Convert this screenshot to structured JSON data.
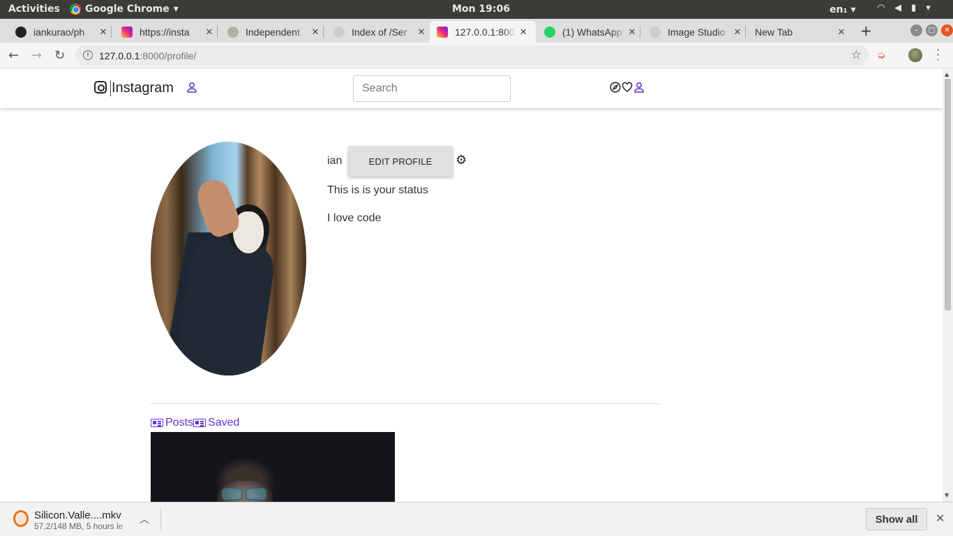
{
  "os_topbar": {
    "activities": "Activities",
    "app_name": "Google Chrome",
    "clock": "Mon 19:06",
    "lang": "en₁ ▾"
  },
  "tabs": [
    {
      "title": "iankurao/ph",
      "icon": "github-icon",
      "color": "#222222"
    },
    {
      "title": "https://insta",
      "icon": "instagram-icon",
      "color": "#d62976"
    },
    {
      "title": "Independent",
      "icon": "globe-icon",
      "color": "#6a7a5a"
    },
    {
      "title": "Index of /Ser",
      "icon": "page-icon",
      "color": "#555555"
    },
    {
      "title": "127.0.0.1:800",
      "icon": "instagram-icon",
      "color": "#d62976",
      "active": true
    },
    {
      "title": "(1) WhatsApp",
      "icon": "whatsapp-icon",
      "color": "#25d366"
    },
    {
      "title": "Image Studio",
      "icon": "page-icon",
      "color": "#555555"
    },
    {
      "title": "New Tab",
      "icon": "",
      "color": ""
    }
  ],
  "address_bar": {
    "host": "127.0.0.1",
    "rest": ":8000/profile/"
  },
  "ig_nav": {
    "brand": "Instagram",
    "search_placeholder": "Search"
  },
  "profile": {
    "username": "ian",
    "edit_label": "EDIT PROFILE",
    "status": "This is is your status",
    "bio": "I love code"
  },
  "profile_tabs": {
    "posts": "Posts",
    "saved": "Saved"
  },
  "downloads": {
    "file_name": "Silicon.Valle....mkv",
    "meta": "57.2/148 MB, 5 hours le",
    "show_all": "Show all"
  },
  "colors": {
    "accent": "#5e35d6",
    "ubuntu_orange": "#e95420"
  }
}
